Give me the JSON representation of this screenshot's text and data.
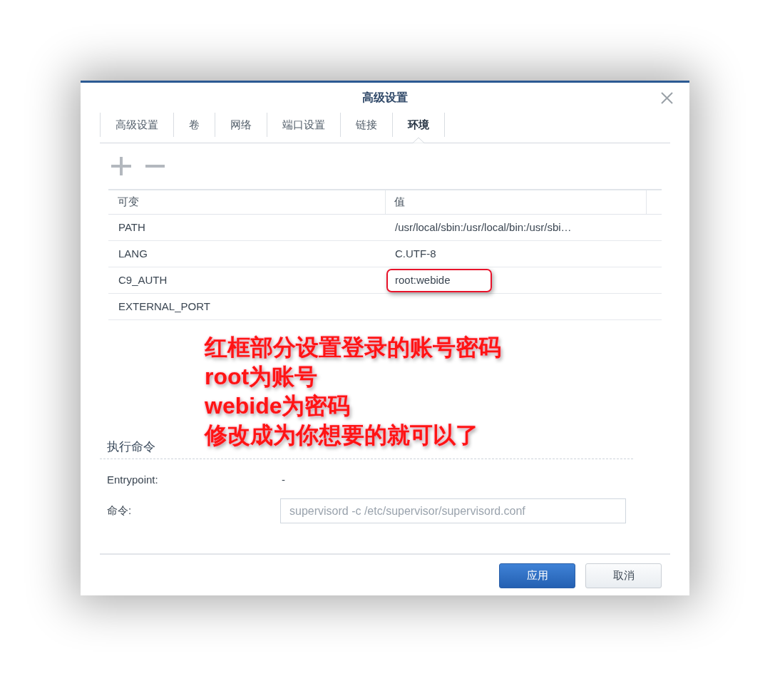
{
  "window": {
    "title": "高级设置"
  },
  "tabs": [
    {
      "label": "高级设置",
      "selected": false
    },
    {
      "label": "卷",
      "selected": false
    },
    {
      "label": "网络",
      "selected": false
    },
    {
      "label": "端口设置",
      "selected": false
    },
    {
      "label": "链接",
      "selected": false
    },
    {
      "label": "环境",
      "selected": true
    }
  ],
  "table": {
    "columns": [
      "可变",
      "值"
    ],
    "rows": [
      {
        "variable": "PATH",
        "value": "/usr/local/sbin:/usr/local/bin:/usr/sbi…",
        "circled": false
      },
      {
        "variable": "LANG",
        "value": "C.UTF-8",
        "circled": false
      },
      {
        "variable": "C9_AUTH",
        "value": "root:webide",
        "circled": true
      },
      {
        "variable": "EXTERNAL_PORT",
        "circled": false
      }
    ]
  },
  "annotation": {
    "lines": [
      "红框部分设置登录的账号密码",
      "root为账号",
      "webide为密码",
      "修改成为你想要的就可以了"
    ]
  },
  "command_section": {
    "title": "执行命令",
    "fields": [
      {
        "kind": "text",
        "label": "Entrypoint:",
        "value": "-"
      },
      {
        "kind": "input",
        "label": "命令:",
        "value": "supervisord -c /etc/supervisor/supervisord.conf",
        "disabled": true
      }
    ]
  },
  "footer": {
    "buttons": [
      {
        "kind": "primary",
        "label": "应用"
      },
      {
        "kind": "secondary",
        "label": "取消"
      }
    ]
  }
}
